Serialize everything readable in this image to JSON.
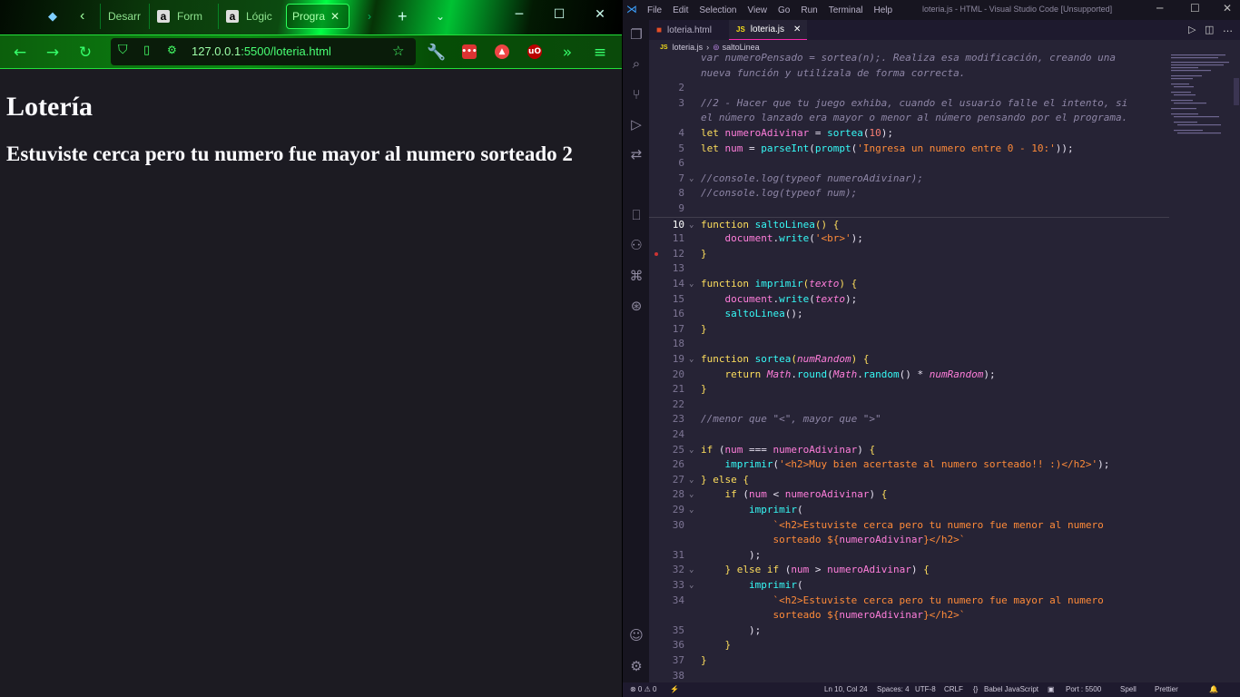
{
  "browser": {
    "tabs": [
      {
        "label": "Desarr"
      },
      {
        "label": "Form"
      },
      {
        "label": "Lógic"
      },
      {
        "label": "Progra"
      }
    ],
    "url_host": "127.0.0.1",
    "url_rest": ":5500/loteria.html",
    "page": {
      "h1": "Lotería",
      "h2": "Estuviste cerca pero tu numero fue mayor al numero sorteado 2"
    }
  },
  "vscode": {
    "menu": [
      "File",
      "Edit",
      "Selection",
      "View",
      "Go",
      "Run",
      "Terminal",
      "Help"
    ],
    "window_title": "loteria.js - HTML - Visual Studio Code [Unsupported]",
    "tabs": [
      {
        "label": "loteria.html"
      },
      {
        "label": "loteria.js"
      }
    ],
    "breadcrumb": {
      "file": "loteria.js",
      "symbol": "saltoLinea"
    },
    "status": {
      "problems": "⊗ 0 ⚠ 0",
      "position": "Ln 10, Col 24",
      "spaces": "Spaces: 4",
      "encoding": "UTF-8",
      "eol": "CRLF",
      "language": "Babel JavaScript",
      "port": "Port : 5500",
      "spell": "Spell",
      "prettier": "Prettier"
    },
    "code": [
      {
        "n": "",
        "tokens": [
          {
            "c": "cm",
            "t": "var numeroPensado = sortea(n);. Realiza esa modificación, creando una"
          }
        ]
      },
      {
        "n": "",
        "tokens": [
          {
            "c": "cm",
            "t": "nueva función y utilízala de forma correcta."
          }
        ]
      },
      {
        "n": "2",
        "tokens": []
      },
      {
        "n": "3",
        "tokens": [
          {
            "c": "cm",
            "t": "//2 - Hacer que tu juego exhiba, cuando el usuario falle el intento, si"
          }
        ]
      },
      {
        "n": "",
        "tokens": [
          {
            "c": "cm",
            "t": "el número lanzado era mayor o menor al número pensando por el programa."
          }
        ]
      },
      {
        "n": "4",
        "tokens": [
          {
            "c": "kw",
            "t": "let "
          },
          {
            "c": "vr",
            "t": "numeroAdivinar"
          },
          {
            "c": "pl",
            "t": " = "
          },
          {
            "c": "fn",
            "t": "sortea"
          },
          {
            "c": "pl",
            "t": "("
          },
          {
            "c": "num",
            "t": "10"
          },
          {
            "c": "pl",
            "t": ");"
          }
        ]
      },
      {
        "n": "5",
        "tokens": [
          {
            "c": "kw",
            "t": "let "
          },
          {
            "c": "vr",
            "t": "num"
          },
          {
            "c": "pl",
            "t": " = "
          },
          {
            "c": "fn",
            "t": "parseInt"
          },
          {
            "c": "pl",
            "t": "("
          },
          {
            "c": "fn",
            "t": "prompt"
          },
          {
            "c": "pl",
            "t": "("
          },
          {
            "c": "str",
            "t": "'Ingresa un numero entre 0 - 10:'"
          },
          {
            "c": "pl",
            "t": "));"
          }
        ]
      },
      {
        "n": "6",
        "tokens": []
      },
      {
        "n": "7",
        "fold": true,
        "tokens": [
          {
            "c": "cm",
            "t": "//console.log(typeof numeroAdivinar);"
          }
        ]
      },
      {
        "n": "8",
        "tokens": [
          {
            "c": "cm",
            "t": "//console.log(typeof num);"
          }
        ]
      },
      {
        "n": "9",
        "tokens": []
      },
      {
        "n": "10",
        "fold": true,
        "cur": true,
        "tokens": [
          {
            "c": "kw",
            "t": "function "
          },
          {
            "c": "fn",
            "t": "saltoLinea"
          },
          {
            "c": "kw",
            "t": "() {"
          }
        ]
      },
      {
        "n": "11",
        "tokens": [
          {
            "c": "pl",
            "t": "    "
          },
          {
            "c": "vr",
            "t": "document"
          },
          {
            "c": "pl",
            "t": "."
          },
          {
            "c": "fn",
            "t": "write"
          },
          {
            "c": "pl",
            "t": "("
          },
          {
            "c": "str",
            "t": "'<br>'"
          },
          {
            "c": "pl",
            "t": ");"
          }
        ]
      },
      {
        "n": "12",
        "tokens": [
          {
            "c": "kw",
            "t": "}"
          }
        ]
      },
      {
        "n": "13",
        "tokens": []
      },
      {
        "n": "14",
        "fold": true,
        "tokens": [
          {
            "c": "kw",
            "t": "function "
          },
          {
            "c": "fn",
            "t": "imprimir"
          },
          {
            "c": "kw",
            "t": "("
          },
          {
            "c": "pr",
            "t": "texto"
          },
          {
            "c": "kw",
            "t": ") {"
          }
        ]
      },
      {
        "n": "15",
        "tokens": [
          {
            "c": "pl",
            "t": "    "
          },
          {
            "c": "vr",
            "t": "document"
          },
          {
            "c": "pl",
            "t": "."
          },
          {
            "c": "fn",
            "t": "write"
          },
          {
            "c": "pl",
            "t": "("
          },
          {
            "c": "pr",
            "t": "texto"
          },
          {
            "c": "pl",
            "t": ");"
          }
        ]
      },
      {
        "n": "16",
        "tokens": [
          {
            "c": "pl",
            "t": "    "
          },
          {
            "c": "fn",
            "t": "saltoLinea"
          },
          {
            "c": "pl",
            "t": "();"
          }
        ]
      },
      {
        "n": "17",
        "tokens": [
          {
            "c": "kw",
            "t": "}"
          }
        ]
      },
      {
        "n": "18",
        "tokens": []
      },
      {
        "n": "19",
        "fold": true,
        "tokens": [
          {
            "c": "kw",
            "t": "function "
          },
          {
            "c": "fn",
            "t": "sortea"
          },
          {
            "c": "kw",
            "t": "("
          },
          {
            "c": "pr",
            "t": "numRandom"
          },
          {
            "c": "kw",
            "t": ") {"
          }
        ]
      },
      {
        "n": "20",
        "tokens": [
          {
            "c": "pl",
            "t": "    "
          },
          {
            "c": "kw",
            "t": "return "
          },
          {
            "c": "pr",
            "t": "Math"
          },
          {
            "c": "pl",
            "t": "."
          },
          {
            "c": "fn",
            "t": "round"
          },
          {
            "c": "pl",
            "t": "("
          },
          {
            "c": "pr",
            "t": "Math"
          },
          {
            "c": "pl",
            "t": "."
          },
          {
            "c": "fn",
            "t": "random"
          },
          {
            "c": "pl",
            "t": "() * "
          },
          {
            "c": "pr",
            "t": "numRandom"
          },
          {
            "c": "pl",
            "t": ");"
          }
        ]
      },
      {
        "n": "21",
        "tokens": [
          {
            "c": "kw",
            "t": "}"
          }
        ]
      },
      {
        "n": "22",
        "tokens": []
      },
      {
        "n": "23",
        "tokens": [
          {
            "c": "cm",
            "t": "//menor que \"<\", mayor que \">\""
          }
        ]
      },
      {
        "n": "24",
        "tokens": []
      },
      {
        "n": "25",
        "fold": true,
        "tokens": [
          {
            "c": "kw",
            "t": "if "
          },
          {
            "c": "pl",
            "t": "("
          },
          {
            "c": "vr",
            "t": "num"
          },
          {
            "c": "pl",
            "t": " === "
          },
          {
            "c": "vr",
            "t": "numeroAdivinar"
          },
          {
            "c": "pl",
            "t": ") "
          },
          {
            "c": "kw",
            "t": "{"
          }
        ]
      },
      {
        "n": "26",
        "tokens": [
          {
            "c": "pl",
            "t": "    "
          },
          {
            "c": "fn",
            "t": "imprimir"
          },
          {
            "c": "pl",
            "t": "("
          },
          {
            "c": "str",
            "t": "'<h2>Muy bien acertaste al numero sorteado!! :)</h2>'"
          },
          {
            "c": "pl",
            "t": ");"
          }
        ]
      },
      {
        "n": "27",
        "fold": true,
        "tokens": [
          {
            "c": "kw",
            "t": "} else {"
          }
        ]
      },
      {
        "n": "28",
        "fold": true,
        "tokens": [
          {
            "c": "pl",
            "t": "    "
          },
          {
            "c": "kw",
            "t": "if "
          },
          {
            "c": "pl",
            "t": "("
          },
          {
            "c": "vr",
            "t": "num"
          },
          {
            "c": "pl",
            "t": " < "
          },
          {
            "c": "vr",
            "t": "numeroAdivinar"
          },
          {
            "c": "pl",
            "t": ") "
          },
          {
            "c": "kw",
            "t": "{"
          }
        ]
      },
      {
        "n": "29",
        "fold": true,
        "tokens": [
          {
            "c": "pl",
            "t": "        "
          },
          {
            "c": "fn",
            "t": "imprimir"
          },
          {
            "c": "pl",
            "t": "("
          }
        ]
      },
      {
        "n": "30",
        "tokens": [
          {
            "c": "pl",
            "t": "            "
          },
          {
            "c": "str",
            "t": "`<h2>Estuviste cerca pero tu numero fue menor al numero"
          }
        ]
      },
      {
        "n": "",
        "tokens": [
          {
            "c": "pl",
            "t": "            "
          },
          {
            "c": "str",
            "t": "sorteado ${"
          },
          {
            "c": "vr",
            "t": "numeroAdivinar"
          },
          {
            "c": "str",
            "t": "}</h2>`"
          }
        ]
      },
      {
        "n": "31",
        "tokens": [
          {
            "c": "pl",
            "t": "        );"
          }
        ]
      },
      {
        "n": "32",
        "fold": true,
        "tokens": [
          {
            "c": "pl",
            "t": "    "
          },
          {
            "c": "kw",
            "t": "} else if "
          },
          {
            "c": "pl",
            "t": "("
          },
          {
            "c": "vr",
            "t": "num"
          },
          {
            "c": "pl",
            "t": " > "
          },
          {
            "c": "vr",
            "t": "numeroAdivinar"
          },
          {
            "c": "pl",
            "t": ") "
          },
          {
            "c": "kw",
            "t": "{"
          }
        ]
      },
      {
        "n": "33",
        "fold": true,
        "tokens": [
          {
            "c": "pl",
            "t": "        "
          },
          {
            "c": "fn",
            "t": "imprimir"
          },
          {
            "c": "pl",
            "t": "("
          }
        ]
      },
      {
        "n": "34",
        "tokens": [
          {
            "c": "pl",
            "t": "            "
          },
          {
            "c": "str",
            "t": "`<h2>Estuviste cerca pero tu numero fue mayor al numero"
          }
        ]
      },
      {
        "n": "",
        "tokens": [
          {
            "c": "pl",
            "t": "            "
          },
          {
            "c": "str",
            "t": "sorteado ${"
          },
          {
            "c": "vr",
            "t": "numeroAdivinar"
          },
          {
            "c": "str",
            "t": "}</h2>`"
          }
        ]
      },
      {
        "n": "35",
        "tokens": [
          {
            "c": "pl",
            "t": "        );"
          }
        ]
      },
      {
        "n": "36",
        "tokens": [
          {
            "c": "pl",
            "t": "    "
          },
          {
            "c": "kw",
            "t": "}"
          }
        ]
      },
      {
        "n": "37",
        "tokens": [
          {
            "c": "kw",
            "t": "}"
          }
        ]
      },
      {
        "n": "38",
        "tokens": []
      }
    ]
  }
}
